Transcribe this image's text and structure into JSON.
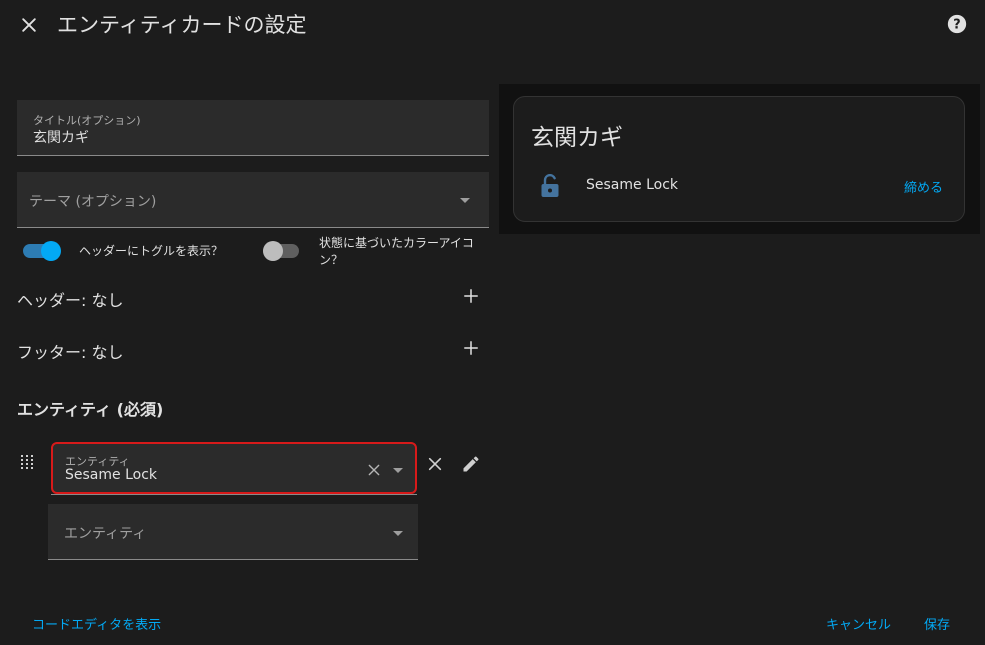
{
  "dialog": {
    "title": "エンティティカードの設定"
  },
  "form": {
    "title_field": {
      "label": "タイトル(オプション)",
      "value": "玄関カギ"
    },
    "theme_field": {
      "placeholder": "テーマ (オプション)"
    },
    "toggle_header": {
      "label": "ヘッダーにトグルを表示？",
      "checked": true
    },
    "toggle_state_color": {
      "label": "状態に基づいたカラーアイコン？",
      "checked": false
    },
    "header_row": {
      "label": "ヘッダー: なし"
    },
    "footer_row": {
      "label": "フッター: なし"
    },
    "entities_heading": "エンティティ (必須)",
    "entity_row": {
      "label": "エンティティ",
      "value": "Sesame Lock"
    },
    "entity_add": {
      "placeholder": "エンティティ"
    }
  },
  "preview": {
    "card_title": "玄関カギ",
    "entity_name": "Sesame Lock",
    "action_label": "締める"
  },
  "footer": {
    "show_code_editor": "コードエディタを表示",
    "cancel": "キャンセル",
    "save": "保存"
  },
  "colors": {
    "accent": "#03a9f4",
    "error_outline": "#d71a1a",
    "lock_icon": "#44739e"
  }
}
